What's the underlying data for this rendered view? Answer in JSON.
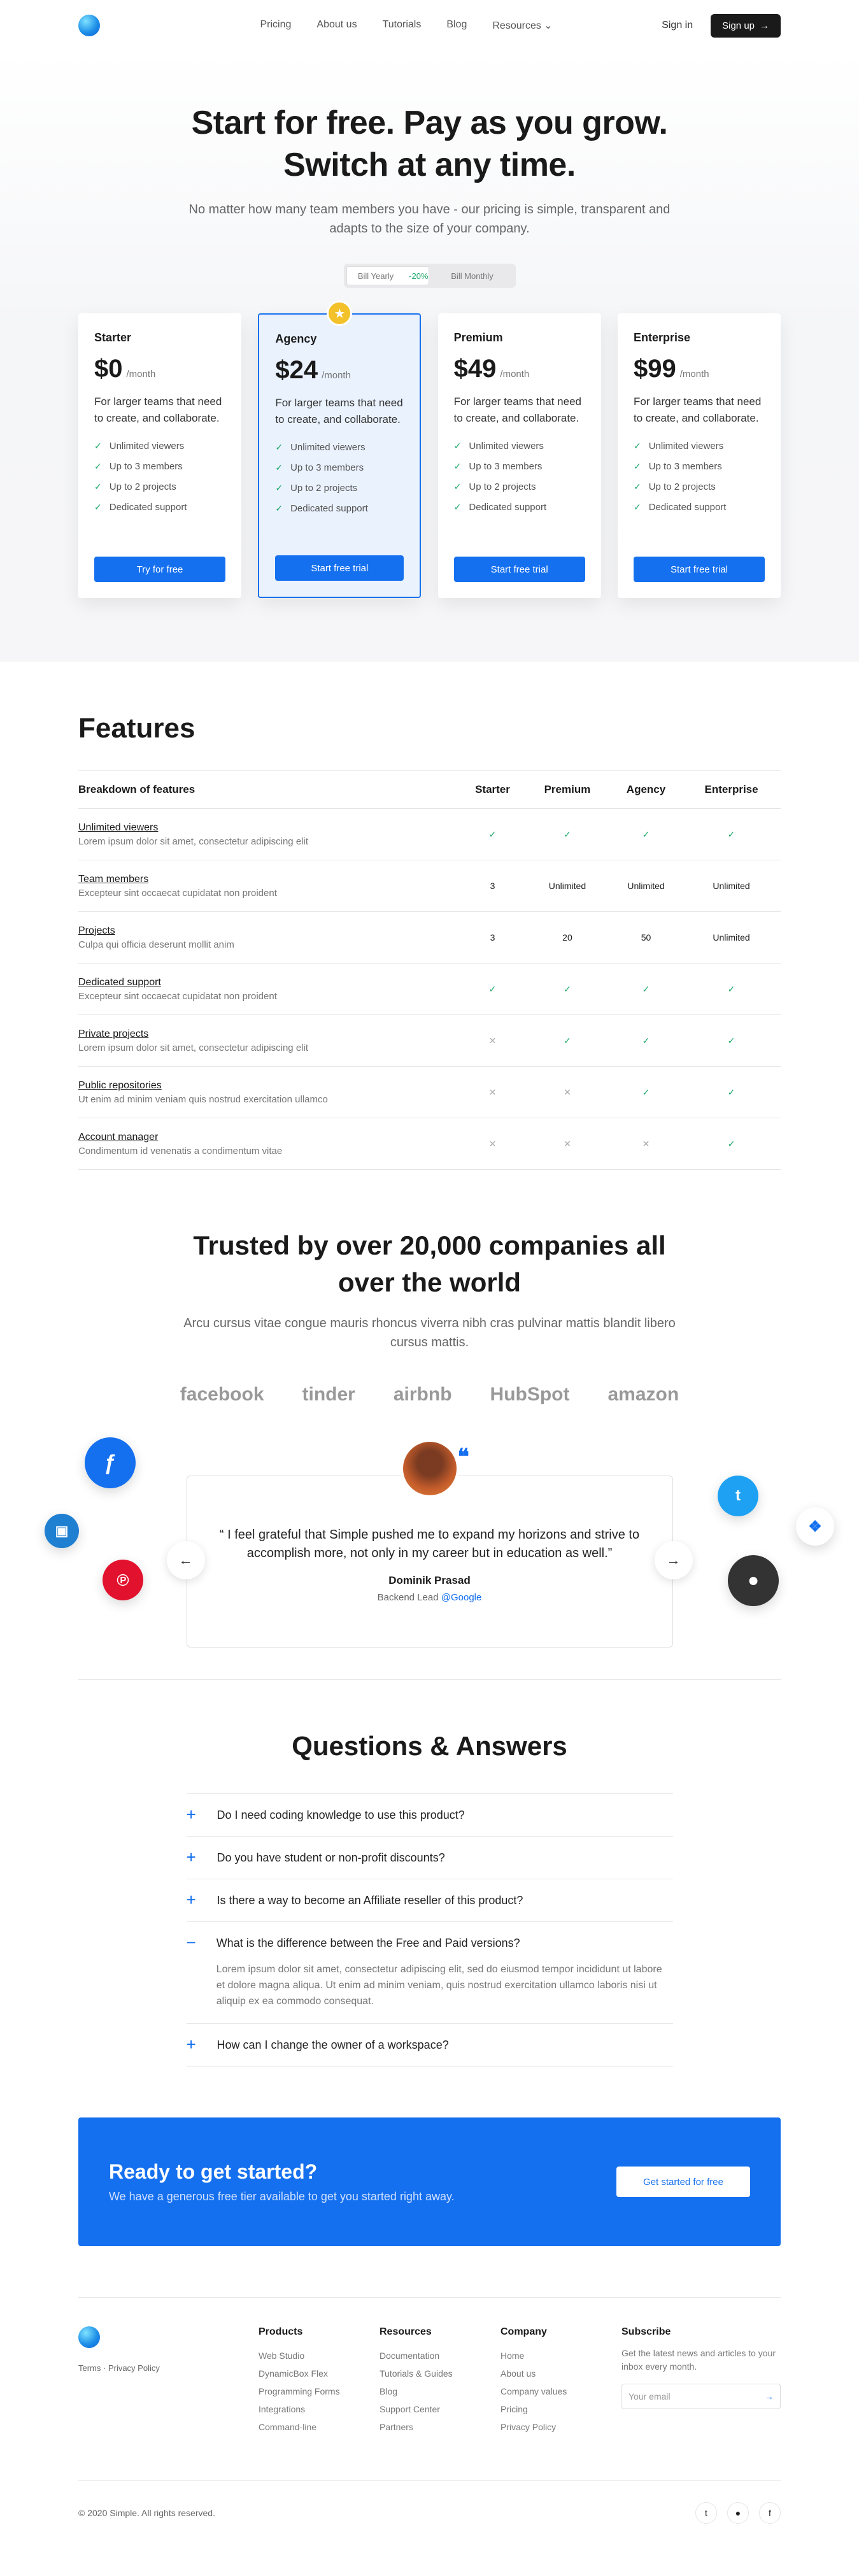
{
  "nav": {
    "links": [
      "Pricing",
      "About us",
      "Tutorials",
      "Blog",
      "Resources"
    ],
    "signin": "Sign in",
    "signup": "Sign up",
    "signup_icon": "arrow-right-icon"
  },
  "hero": {
    "title_line1": "Start for free. Pay as you grow.",
    "title_line2": "Switch at any time.",
    "subtitle": "No matter how many team members you have - our pricing is simple, transparent and adapts to the size of your company.",
    "toggle_yearly": "Bill Yearly",
    "toggle_discount": "-20%",
    "toggle_monthly": "Bill Monthly"
  },
  "plans": [
    {
      "name": "Starter",
      "price": "$0",
      "period": "/month",
      "desc": "For larger teams that need to create, and collaborate.",
      "features": [
        "Unlimited viewers",
        "Up to 3 members",
        "Up to 2 projects",
        "Dedicated support"
      ],
      "button": "Try for free",
      "featured": false
    },
    {
      "name": "Agency",
      "price": "$24",
      "period": "/month",
      "desc": "For larger teams that need to create, and collaborate.",
      "features": [
        "Unlimited viewers",
        "Up to 3 members",
        "Up to 2 projects",
        "Dedicated support"
      ],
      "button": "Start free trial",
      "featured": true
    },
    {
      "name": "Premium",
      "price": "$49",
      "period": "/month",
      "desc": "For larger teams that need to create, and collaborate.",
      "features": [
        "Unlimited viewers",
        "Up to 3 members",
        "Up to 2 projects",
        "Dedicated support"
      ],
      "button": "Start free trial",
      "featured": false
    },
    {
      "name": "Enterprise",
      "price": "$99",
      "period": "/month",
      "desc": "For larger teams that need to create, and collaborate.",
      "features": [
        "Unlimited viewers",
        "Up to 3 members",
        "Up to 2 projects",
        "Dedicated support"
      ],
      "button": "Start free trial",
      "featured": false
    }
  ],
  "features": {
    "title": "Features",
    "headers": [
      "Breakdown of features",
      "Starter",
      "Premium",
      "Agency",
      "Enterprise"
    ],
    "rows": [
      {
        "name": "Unlimited viewers",
        "desc": "Lorem ipsum dolor sit amet, consectetur adipiscing elit",
        "cells": [
          "✓",
          "✓",
          "✓",
          "✓"
        ]
      },
      {
        "name": "Team members",
        "desc": "Excepteur sint occaecat cupidatat non proident",
        "cells": [
          "3",
          "Unlimited",
          "Unlimited",
          "Unlimited"
        ]
      },
      {
        "name": "Projects",
        "desc": "Culpa qui officia deserunt mollit anim",
        "cells": [
          "3",
          "20",
          "50",
          "Unlimited"
        ]
      },
      {
        "name": "Dedicated support",
        "desc": "Excepteur sint occaecat cupidatat non proident",
        "cells": [
          "✓",
          "✓",
          "✓",
          "✓"
        ]
      },
      {
        "name": "Private projects",
        "desc": "Lorem ipsum dolor sit amet, consectetur adipiscing elit",
        "cells": [
          "✕",
          "✓",
          "✓",
          "✓"
        ]
      },
      {
        "name": "Public repositories",
        "desc": "Ut enim ad minim veniam quis nostrud exercitation ullamco",
        "cells": [
          "✕",
          "✕",
          "✓",
          "✓"
        ]
      },
      {
        "name": "Account manager",
        "desc": "Condimentum id venenatis a condimentum vitae",
        "cells": [
          "✕",
          "✕",
          "✕",
          "✓"
        ]
      }
    ]
  },
  "trusted": {
    "title": "Trusted by over 20,000 companies all over the world",
    "subtitle": "Arcu cursus vitae congue mauris rhoncus viverra nibh cras pulvinar mattis blandit libero cursus mattis.",
    "logos": [
      "facebook",
      "tinder",
      "airbnb",
      "HubSpot",
      "amazon"
    ],
    "quote": "“ I feel grateful that Simple pushed me to expand my horizons and strive to accomplish more, not only in my career but in education as well.”",
    "author": "Dominik Prasad",
    "role": "Backend Lead",
    "company": "@Google"
  },
  "faq": {
    "title": "Questions & Answers",
    "items": [
      {
        "q": "Do I need coding knowledge to use this product?",
        "open": false,
        "a": ""
      },
      {
        "q": "Do you have student or non-profit discounts?",
        "open": false,
        "a": ""
      },
      {
        "q": "Is there a way to become an Affiliate reseller of this product?",
        "open": false,
        "a": ""
      },
      {
        "q": "What is the difference between the Free and Paid versions?",
        "open": true,
        "a": "Lorem ipsum dolor sit amet, consectetur adipiscing elit, sed do eiusmod tempor incididunt ut labore et dolore magna aliqua. Ut enim ad minim veniam, quis nostrud exercitation ullamco laboris nisi ut aliquip ex ea commodo consequat."
      },
      {
        "q": "How can I change the owner of a workspace?",
        "open": false,
        "a": ""
      }
    ]
  },
  "cta": {
    "title": "Ready to get started?",
    "subtitle": "We have a generous free tier available to get you started right away.",
    "button": "Get started for free"
  },
  "footer": {
    "legal": "Terms · Privacy Policy",
    "columns": [
      {
        "title": "Products",
        "links": [
          "Web Studio",
          "DynamicBox Flex",
          "Programming Forms",
          "Integrations",
          "Command-line"
        ]
      },
      {
        "title": "Resources",
        "links": [
          "Documentation",
          "Tutorials & Guides",
          "Blog",
          "Support Center",
          "Partners"
        ]
      },
      {
        "title": "Company",
        "links": [
          "Home",
          "About us",
          "Company values",
          "Pricing",
          "Privacy Policy"
        ]
      }
    ],
    "subscribe_title": "Subscribe",
    "subscribe_text": "Get the latest news and articles to your inbox every month.",
    "email_placeholder": "Your email",
    "copyright": "© 2020 Simple. All rights reserved."
  },
  "colors": {
    "accent": "#1570ef",
    "check": "#1fa86a",
    "star": "#f3c12a"
  }
}
